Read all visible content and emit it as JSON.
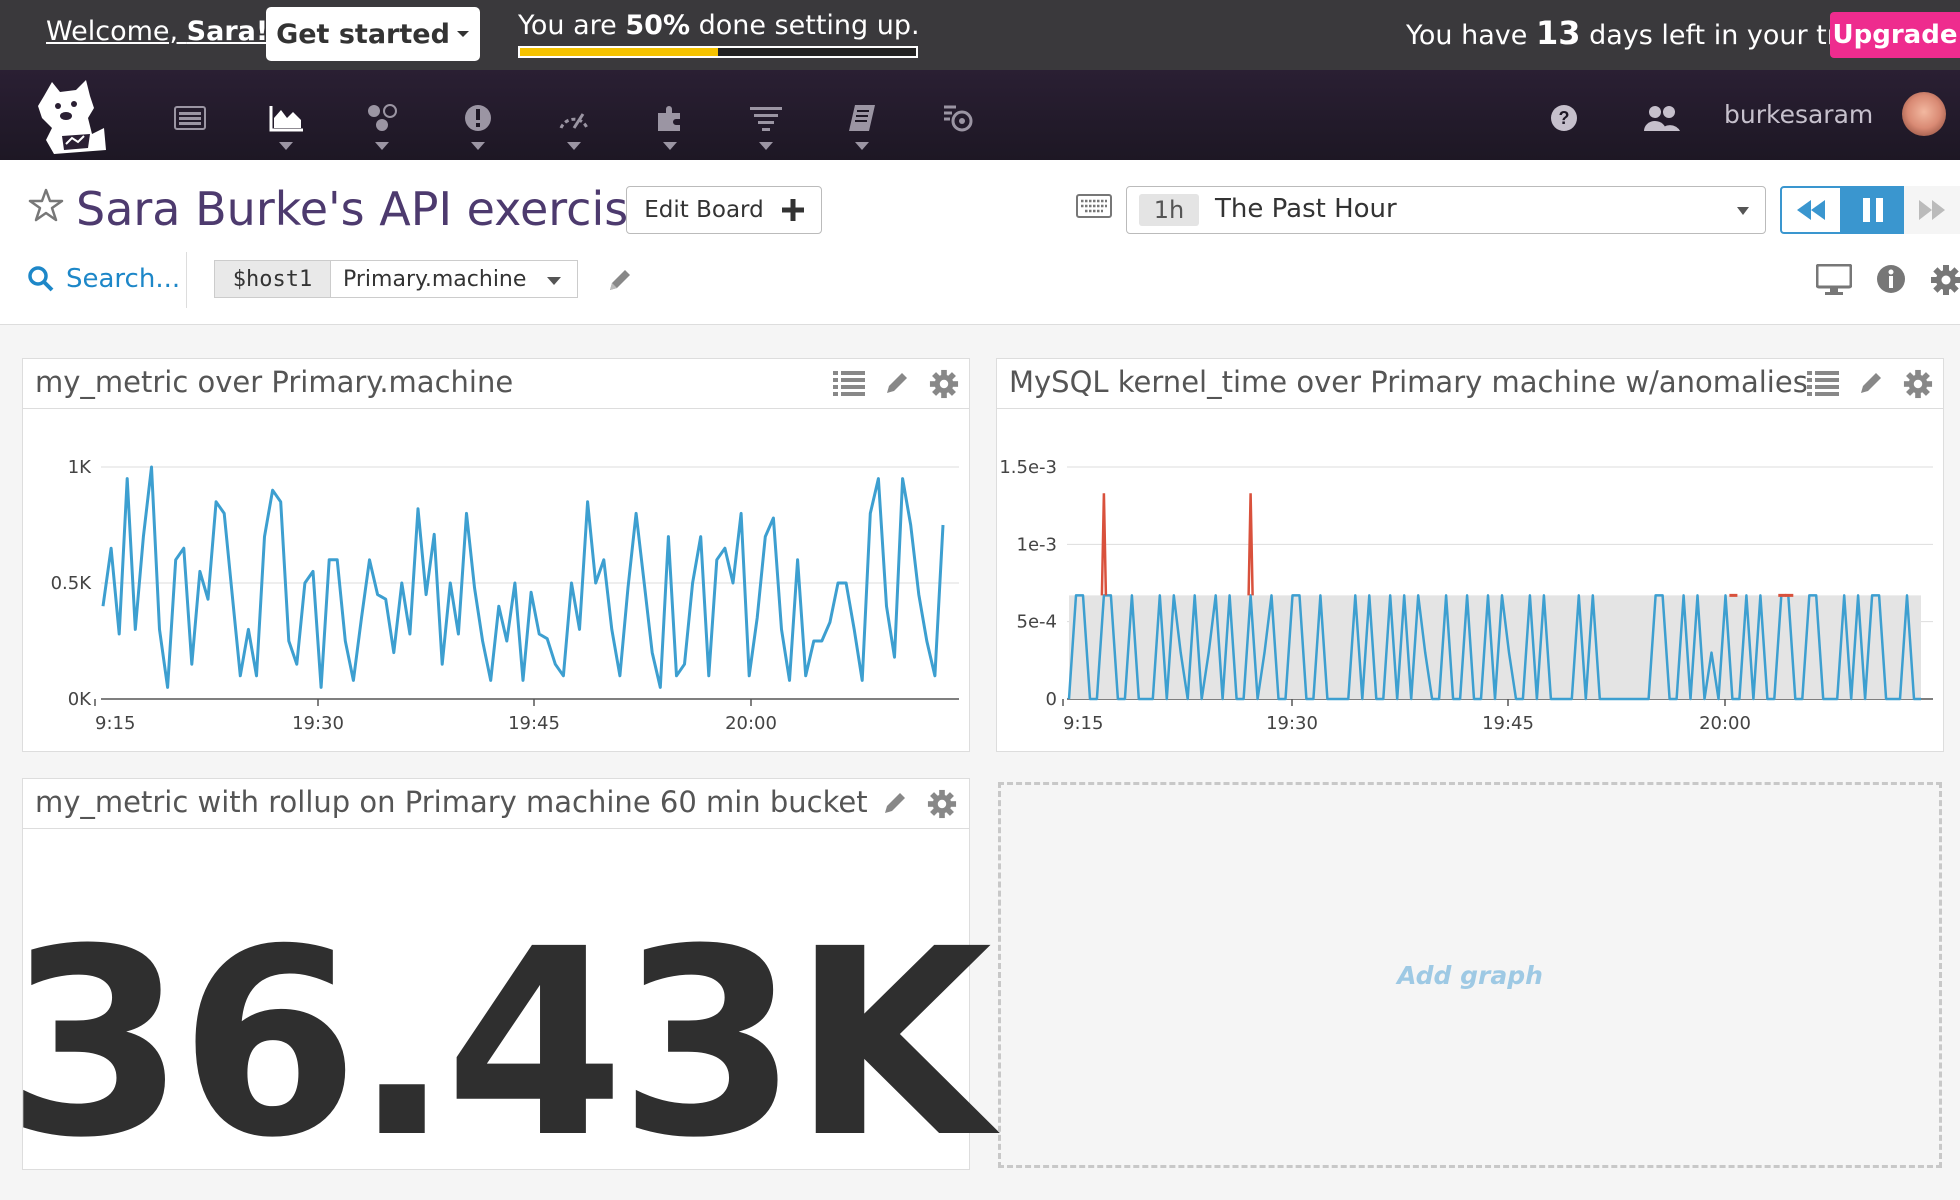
{
  "banner": {
    "welcome_prefix": "Welcome, ",
    "welcome_name": "Sara!",
    "get_started": "Get started",
    "progress_prefix": "You are ",
    "progress_value": "50%",
    "progress_suffix": " done setting up.",
    "progress_fraction": 0.5,
    "trial_prefix": "You have ",
    "trial_days": "13",
    "trial_suffix": " days left in your trial.",
    "upgrade": "Upgrade"
  },
  "navbar": {
    "icons": [
      "logo-dog-icon",
      "events-icon",
      "dashboards-icon",
      "infrastructure-icon",
      "monitors-icon",
      "metrics-icon",
      "integrations-icon",
      "logs-icon",
      "notebooks-icon",
      "watchdog-icon"
    ],
    "right_icons": [
      "help-icon",
      "team-icon"
    ],
    "username": "burkesaram"
  },
  "header": {
    "title": "Sara Burke's API exercise",
    "edit_board": "Edit Board",
    "time_badge": "1h",
    "time_label": "The Past Hour",
    "search_placeholder": "Search...",
    "var_name": "$host1",
    "var_value": "Primary.machine"
  },
  "widgets": {
    "w1_title": "my_metric over Primary.machine",
    "w2_title": "MySQL kernel_time over Primary machine w/anomalies",
    "w3_title": "my_metric with rollup on Primary machine 60 min bucket",
    "w3_value": "36.43K",
    "add_graph": "Add graph"
  },
  "colors": {
    "accent": "#3a96cf",
    "line": "#3d9fd0",
    "anomaly": "#d9513c",
    "upgrade": "#ee2c8e",
    "progress": "#f5c200",
    "title": "#4d3a6e"
  },
  "chart_data": [
    {
      "type": "line",
      "x_ticks": [
        "9:15",
        "19:30",
        "19:45",
        "20:00"
      ],
      "y_ticks": [
        "0K",
        "0.5K",
        "1K"
      ],
      "ylim": [
        0,
        1000
      ],
      "series": [
        {
          "values": [
            400,
            650,
            280,
            950,
            300,
            700,
            1000,
            300,
            50,
            600,
            650,
            150,
            550,
            430,
            850,
            800,
            450,
            100,
            300,
            100,
            700,
            900,
            850,
            250,
            150,
            500,
            550,
            50,
            600,
            600,
            250,
            80,
            350,
            600,
            450,
            430,
            200,
            500,
            280,
            820,
            450,
            710,
            150,
            500,
            280,
            800,
            480,
            250,
            80,
            400,
            250,
            500,
            80,
            460,
            280,
            260,
            150,
            100,
            500,
            300,
            850,
            500,
            600,
            300,
            100,
            480,
            800,
            500,
            200,
            50,
            700,
            100,
            150,
            500,
            700,
            100,
            600,
            650,
            500,
            800,
            100,
            350,
            700,
            780,
            300,
            80,
            600,
            100,
            250,
            250,
            330,
            500,
            500,
            300,
            80,
            800,
            950,
            400,
            180,
            950,
            750,
            450,
            250,
            100,
            750
          ]
        }
      ]
    },
    {
      "type": "line",
      "x_ticks": [
        "9:15",
        "19:30",
        "19:45",
        "20:00"
      ],
      "y_ticks": [
        "0",
        "5e-4",
        "1e-3",
        "1.5e-3"
      ],
      "ylim": [
        0,
        0.0015
      ],
      "anomaly_band": [
        0,
        0.00067
      ],
      "series": [
        {
          "values": [
            0,
            0.00067,
            0.00067,
            0,
            0,
            0.00067,
            0.00067,
            0,
            0,
            0.00067,
            0,
            0,
            0,
            0.00067,
            0,
            0.00067,
            0.0003,
            0,
            0.00067,
            0,
            0.0003,
            0.00067,
            0,
            0.00067,
            0,
            0,
            0.00067,
            0,
            0.0003,
            0.00067,
            0,
            0,
            0.00067,
            0.00067,
            0,
            0,
            0.00067,
            0,
            0,
            0,
            0,
            0.00067,
            0,
            0.00067,
            0,
            0,
            0.00067,
            0,
            0.00067,
            0,
            0.00067,
            0.0003,
            0,
            0,
            0.00067,
            0,
            0,
            0.00067,
            0,
            0,
            0.00067,
            0,
            0.00067,
            0.0003,
            0,
            0,
            0.00067,
            0,
            0.00067,
            0,
            0,
            0,
            0,
            0.00067,
            0,
            0.00067,
            0,
            0,
            0,
            0,
            0,
            0,
            0,
            0,
            0.00067,
            0.00067,
            0,
            0,
            0.00067,
            0,
            0.00067,
            0,
            0.0003,
            0,
            0.00067,
            0,
            0,
            0.00067,
            0,
            0.00067,
            0,
            0,
            0.00067,
            0.00067,
            0,
            0,
            0.00067,
            0.00067,
            0,
            0,
            0,
            0.00067,
            0,
            0.00067,
            0,
            0.00067,
            0.00067,
            0,
            0,
            0,
            0.00067,
            0,
            0
          ]
        },
        {
          "anomaly_points": [
            [
              5,
              0.00133
            ],
            [
              26,
              0.00133
            ],
            [
              95,
              0.00067
            ],
            [
              102,
              0.00067
            ],
            [
              103,
              0.00067
            ]
          ]
        }
      ]
    }
  ]
}
